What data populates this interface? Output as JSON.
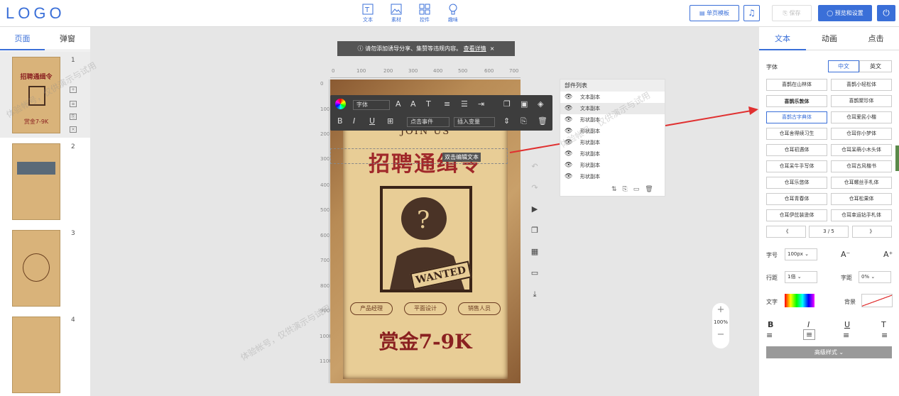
{
  "header": {
    "logo": "LOGO",
    "tools": [
      {
        "label": "文本",
        "icon": "text-icon"
      },
      {
        "label": "素材",
        "icon": "image-icon"
      },
      {
        "label": "控件",
        "icon": "widgets-icon"
      },
      {
        "label": "趣味",
        "icon": "bulb-icon"
      }
    ],
    "template_btn": "单页模板",
    "save_btn": "保存",
    "preview_btn": "预览和设置"
  },
  "left": {
    "tabs": [
      "页面",
      "弹窗"
    ],
    "pages": [
      "1",
      "2",
      "3",
      "4"
    ]
  },
  "banner": {
    "text": "请勿添加诱导分享、集赞等违规内容。",
    "link": "查看详情"
  },
  "ruler_h": [
    "0",
    "100",
    "200",
    "300",
    "400",
    "500",
    "600",
    "700"
  ],
  "ruler_v": [
    "0",
    "100",
    "200",
    "300",
    "400",
    "500",
    "600",
    "700",
    "800",
    "900",
    "1000",
    "1100"
  ],
  "poster": {
    "top": "JOIN US",
    "title": "招聘通缉令",
    "badge": "WANTED",
    "roles": [
      "产品经理",
      "平面设计",
      "销售人员"
    ],
    "salary": "赏金7-9K"
  },
  "text_toolbar": {
    "font": "字体",
    "click_event": "点击事件",
    "insert_var": "插入变量",
    "tooltip": "双击编辑文本"
  },
  "component_list": {
    "title": "部件列表",
    "rows": [
      "文本副本",
      "文本副本",
      "形状副本",
      "形状副本",
      "形状副本",
      "形状副本",
      "形状副本",
      "形状副本"
    ]
  },
  "zoom": "100%",
  "right": {
    "tabs": [
      "文本",
      "动画",
      "点击"
    ],
    "font_label": "字体",
    "lang": [
      "中文",
      "英文"
    ],
    "fonts": [
      "喜鹊在山林体",
      "喜鹊小轻松体",
      "喜鹊乐敦体",
      "喜鹊聚珍体",
      "喜鹊古字典体",
      "仓耳爱民小楷",
      "仓耳舍得续习生",
      "仓耳你小梦体",
      "仓耳初遇体",
      "仓耳呆萌小木头体",
      "仓耳呆牛手写体",
      "仓耳古风楷书",
      "仓耳乐悠体",
      "仓耳螺丝手札体",
      "仓耳青春体",
      "仓耳松果体",
      "仓耳伊芘装逊体",
      "仓耳幸运钻手札体"
    ],
    "pager": {
      "prev": "《",
      "page": "3 / 5",
      "next": "》"
    },
    "size_label": "字号",
    "size_val": "100px",
    "line_label": "行距",
    "line_val": "1倍",
    "spacing_label": "字距",
    "spacing_val": "0%",
    "color_label": "文字",
    "bg_label": "背景",
    "advanced": "高级样式"
  },
  "watermark": "体验帐号，仅供演示与试用"
}
